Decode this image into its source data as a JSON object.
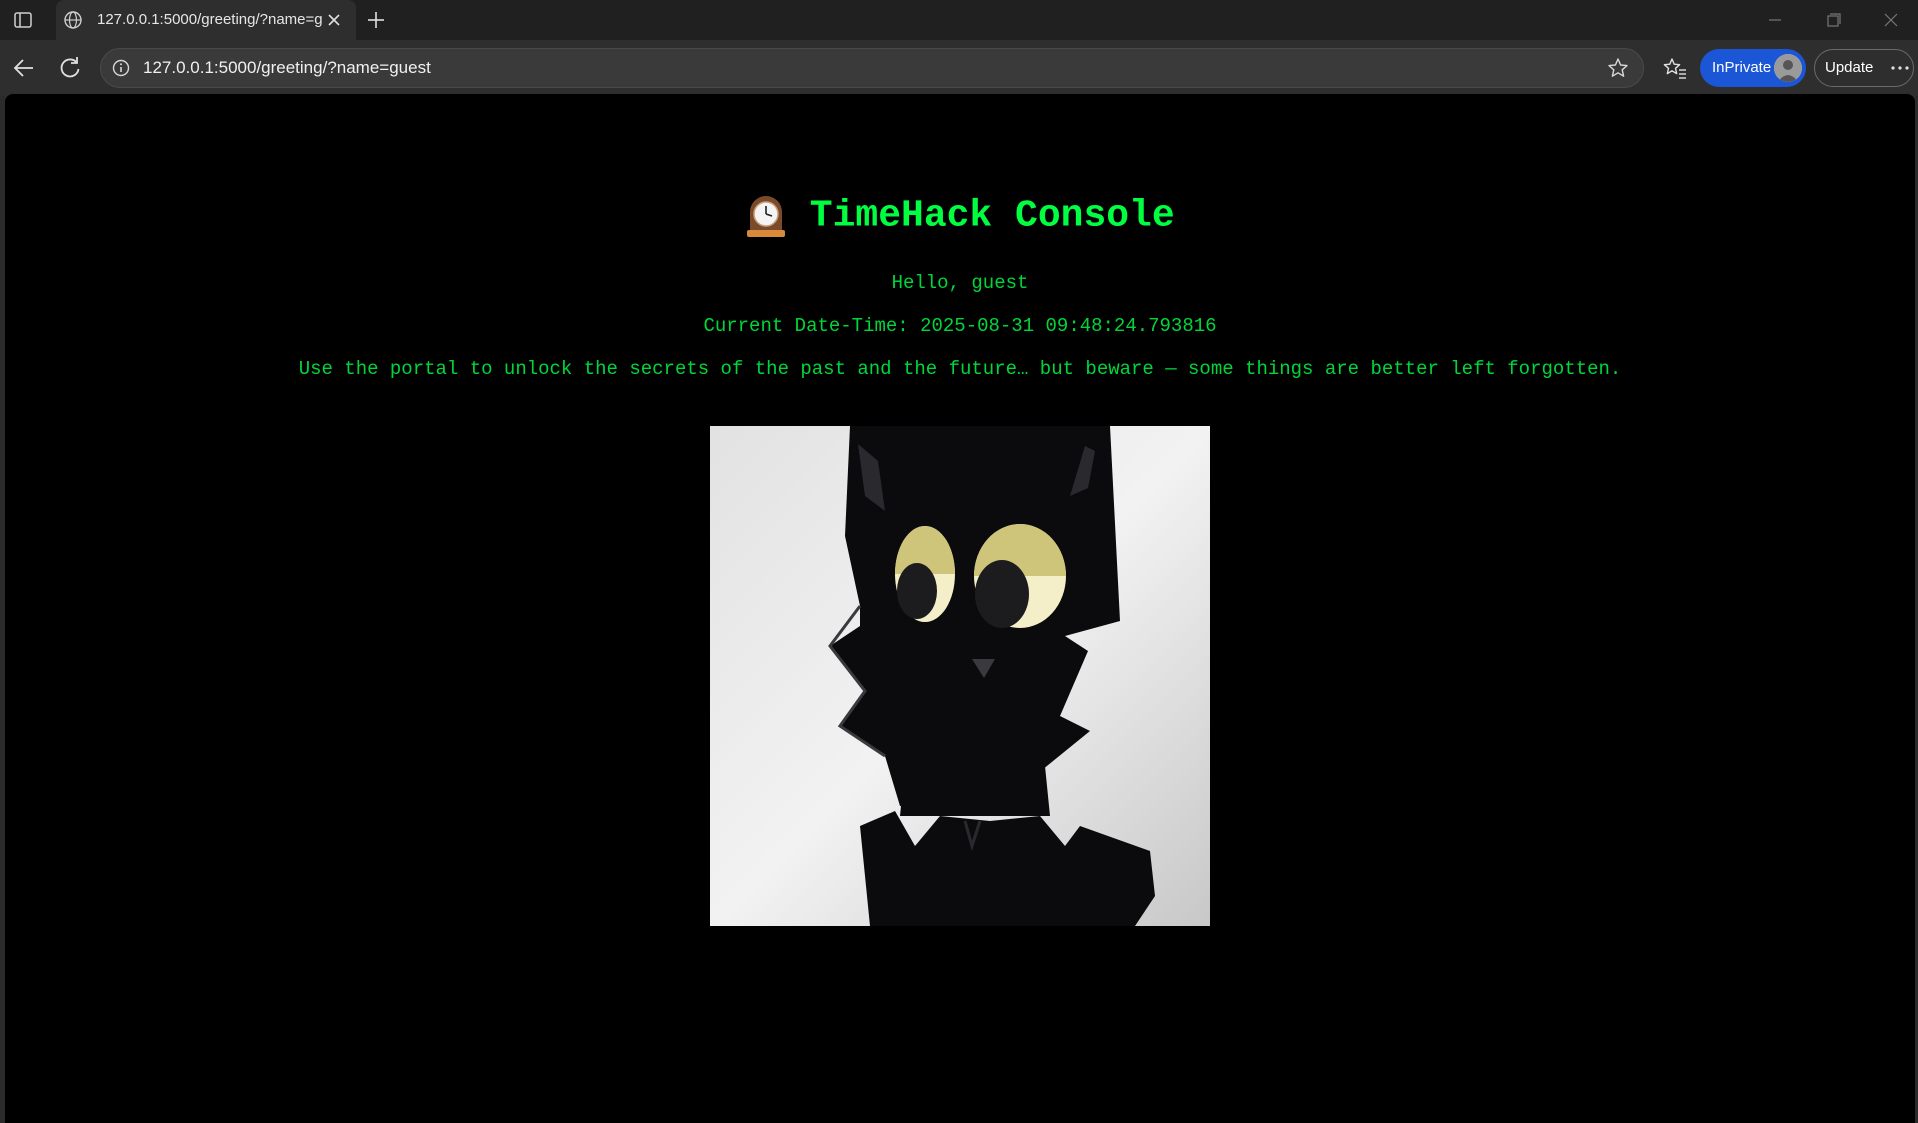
{
  "browser": {
    "tab": {
      "title": "127.0.0.1:5000/greeting/?name=g"
    },
    "address": {
      "url": "127.0.0.1:5000/greeting/?name=guest"
    },
    "profile": {
      "label": "InPrivate"
    },
    "update": {
      "label": "Update"
    }
  },
  "page": {
    "title": "TimeHack Console",
    "greeting": "Hello, guest",
    "datetime": "Current Date-Time: 2025-08-31 09:48:24.793816",
    "message": "Use the portal to unlock the secrets of the past and the future… but beware — some things are better left forgotten."
  },
  "colors": {
    "accent": "#00ff41",
    "text": "#00d63a",
    "background": "#000000",
    "inprivate": "#1a56d6"
  },
  "icons": [
    "sidebar-icon",
    "globe-icon",
    "close-icon",
    "plus-icon",
    "minimize-icon",
    "restore-icon",
    "back-icon",
    "refresh-icon",
    "info-icon",
    "star-icon",
    "favorites-icon",
    "more-icon",
    "clock-icon"
  ]
}
